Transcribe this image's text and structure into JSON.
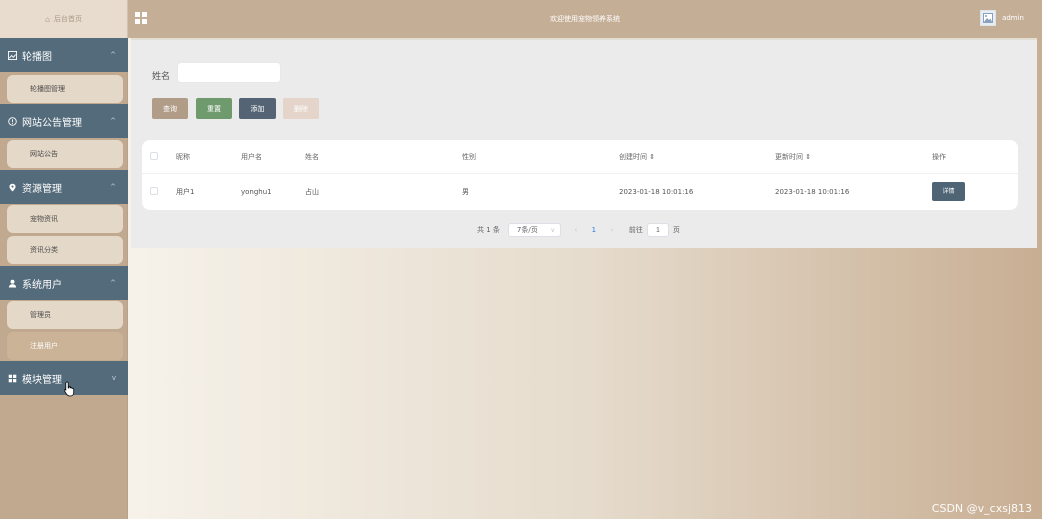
{
  "header": {
    "home_label": "后台首页",
    "system_title": "欢迎使用宠物领养系统",
    "username": "admin"
  },
  "sidebar": {
    "groups": [
      {
        "label": "轮播图",
        "icon": "image-icon",
        "expanded": true
      },
      {
        "label": "网站公告管理",
        "icon": "info-circle-icon",
        "expanded": true
      },
      {
        "label": "资源管理",
        "icon": "location-pin-icon",
        "expanded": true
      },
      {
        "label": "系统用户",
        "icon": "user-icon",
        "expanded": true
      },
      {
        "label": "模块管理",
        "icon": "grid-icon",
        "expanded": false
      }
    ],
    "items": [
      {
        "label": "轮播图管理",
        "active": false
      },
      {
        "label": "网站公告",
        "active": false
      },
      {
        "label": "宠物资讯",
        "active": false
      },
      {
        "label": "资讯分类",
        "active": false
      },
      {
        "label": "管理员",
        "active": false
      },
      {
        "label": "注册用户",
        "active": true
      }
    ]
  },
  "search": {
    "label": "姓名",
    "value": "",
    "placeholder": ""
  },
  "toolbar": {
    "query_label": "查询",
    "reset_label": "重置",
    "add_label": "添加",
    "delete_label": "删除"
  },
  "table": {
    "columns": [
      "昵称",
      "用户名",
      "姓名",
      "性别",
      "创建时间 ⇕",
      "更新时间 ⇕",
      "操作"
    ],
    "rows": [
      {
        "nickname": "用户1",
        "username": "yonghu1",
        "name": "占山",
        "gender": "男",
        "created": "2023-01-18 10:01:16",
        "updated": "2023-01-18 10:01:16",
        "action": "详情"
      }
    ]
  },
  "pagination": {
    "total": "共 1 条",
    "page_size": "7条/页",
    "current": "1",
    "goto_prefix": "前往",
    "goto_value": "1",
    "goto_suffix": "页"
  },
  "watermark": "CSDN @v_cxsj813",
  "colors": {
    "topbar": "#c5ae96",
    "sidebar_group": "#546b7b",
    "menu_item": "#e4d8c8",
    "menu_item_active": "#cbb397",
    "btn_query": "#b19c88",
    "btn_reset": "#6f9a6e",
    "btn_add": "#546474",
    "btn_delete": "#e4d4c9"
  }
}
